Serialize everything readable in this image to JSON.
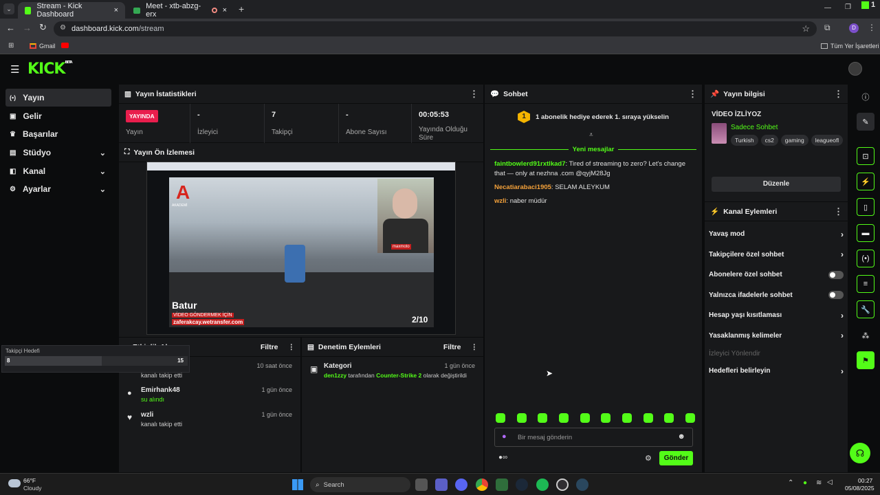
{
  "browser": {
    "tabs": [
      {
        "label": "Stream - Kick Dashboard",
        "active": true
      },
      {
        "label": "Meet - xtb-abzg-erx",
        "active": false
      }
    ],
    "url_host": "dashboard.kick.com",
    "url_path": "/stream",
    "profile_initial": "D",
    "bookmarks": [
      "Gmail"
    ],
    "all_bookmarks_label": "Tüm Yer İşaretleri",
    "ext_count": "1"
  },
  "app": {
    "logo": "KICK",
    "logo_badge": "BETA",
    "nav": [
      {
        "label": "Yayın",
        "icon": "broadcast-icon",
        "expandable": false
      },
      {
        "label": "Gelir",
        "icon": "revenue-icon",
        "expandable": false
      },
      {
        "label": "Başarılar",
        "icon": "trophy-icon",
        "expandable": false
      },
      {
        "label": "Stüdyo",
        "icon": "studio-icon",
        "expandable": true
      },
      {
        "label": "Kanal",
        "icon": "channel-icon",
        "expandable": true
      },
      {
        "label": "Ayarlar",
        "icon": "settings-icon",
        "expandable": true
      }
    ]
  },
  "stats": {
    "title": "Yayın İstatistikleri",
    "live_badge": "YAYINDA",
    "live_label": "Yayın",
    "items": [
      {
        "value": "-",
        "label": "İzleyici"
      },
      {
        "value": "7",
        "label": "Takipçi"
      },
      {
        "value": "-",
        "label": "Abone Sayısı"
      },
      {
        "value": "00:05:53",
        "label": "Yayında Olduğu Süre"
      }
    ]
  },
  "preview": {
    "title": "Yayın Ön İzlemesi",
    "overlay_brand": "AKADEMİ",
    "overlay_name": "Batur",
    "overlay_cta": "VİDEO GÖNDERMEK İÇİN",
    "overlay_site": "zaferakcay.wetransfer.com",
    "overlay_count": "2/10",
    "overlay_logo": "maxmoto"
  },
  "follower_goal": {
    "label": "Takipçi Hedefi",
    "current": "8",
    "target": "15",
    "progress": 0.53
  },
  "activity": {
    "title": "Etkinlik Akışı",
    "filter": "Filtre",
    "items": [
      {
        "user": "",
        "action": "kanalı takip etti",
        "time": "10 saat önce",
        "icon": "heart-icon"
      },
      {
        "user": "Emirhank48",
        "action": "su alındı",
        "time": "1 gün önce",
        "icon": "drops-icon"
      },
      {
        "user": "wzli",
        "action": "kanalı takip etti",
        "time": "1 gün önce",
        "icon": "heart-icon"
      }
    ]
  },
  "moderation": {
    "title": "Denetim Eylemleri",
    "filter": "Filtre",
    "item_title": "Kategori",
    "item_user": "den1zzy",
    "item_text1": "tarafından",
    "item_category": "Counter-Strike 2",
    "item_text2": "olarak değiştirildi",
    "item_time": "1 gün önce"
  },
  "chat": {
    "title": "Sohbet",
    "banner": "1 abonelik hediye ederek 1. sıraya yükselin",
    "banner_rank": "1",
    "new_messages": "Yeni mesajlar",
    "messages": [
      {
        "user": "faintbowlerd91rxtlkad7",
        "color": "#53fc18",
        "text": "Tired of streaming to zero? Let's change that — only at nezhna .com @qyjM28Jg"
      },
      {
        "user": "Necatiarabaci1905",
        "color": "#f4a13a",
        "text": "SELAM ALEYKUM"
      },
      {
        "user": "wzli",
        "color": "#f4a13a",
        "text": "naber müdür"
      }
    ],
    "input_placeholder": "Bir mesaj gönderin",
    "send": "Gönder",
    "emote_count": 10
  },
  "stream_info": {
    "title": "Yayın bilgisi",
    "stream_title": "VİDEO İZLİYOZ",
    "category": "Sadece Sohbet",
    "tags": [
      "Turkish",
      "cs2",
      "gaming",
      "leagueofl"
    ],
    "edit": "Düzenle"
  },
  "channel_actions": {
    "title": "Kanal Eylemleri",
    "rows": [
      {
        "label": "Yavaş mod",
        "control": "chevron"
      },
      {
        "label": "Takipçilere özel sohbet",
        "control": "chevron"
      },
      {
        "label": "Abonelere özel sohbet",
        "control": "toggle"
      },
      {
        "label": "Yalnızca ifadelerle sohbet",
        "control": "toggle"
      },
      {
        "label": "Hesap yaşı kısıtlaması",
        "control": "chevron"
      },
      {
        "label": "Yasaklanmış kelimeler",
        "control": "chevron"
      },
      {
        "label": "İzleyici Yönlendir",
        "control": "none"
      },
      {
        "label": "Hedefleri belirleyin",
        "control": "chevron"
      }
    ]
  },
  "taskbar": {
    "weather_temp": "66°F",
    "weather_desc": "Cloudy",
    "search": "Search",
    "time": "00:27",
    "date": "05/08/2025"
  },
  "colors": {
    "accent": "#53fc18",
    "live": "#e91e4d",
    "panel": "#18191b",
    "bg": "#0b0c0d"
  }
}
